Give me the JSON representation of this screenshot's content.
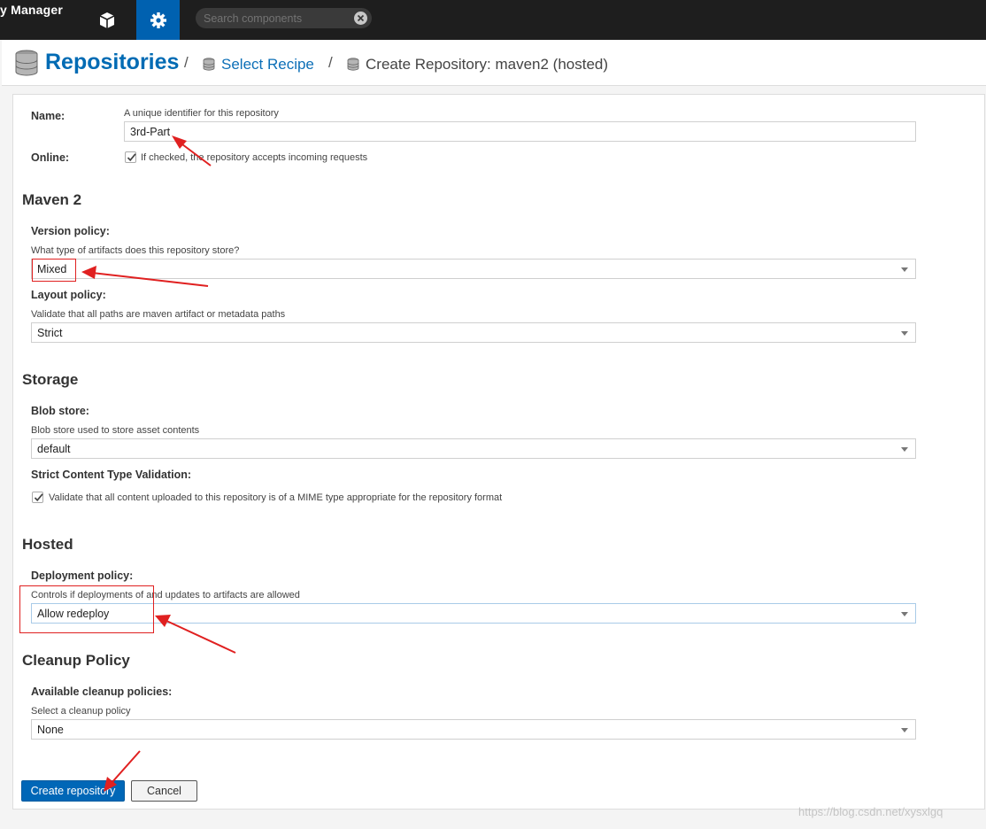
{
  "topbar": {
    "app_name": "y Manager",
    "browse_icon": "cube-icon",
    "admin_icon": "gear-icon",
    "search_placeholder": "Search components",
    "clear_icon": "close-circle-icon"
  },
  "breadcrumb": {
    "title": "Repositories",
    "separator": "/",
    "link": "Select Recipe",
    "current": "Create Repository: maven2 (hosted)"
  },
  "form": {
    "name": {
      "label": "Name:",
      "help": "A unique identifier for this repository",
      "value": "3rd-Part"
    },
    "online": {
      "label": "Online:",
      "help": "If checked, the repository accepts incoming requests",
      "checked": true
    },
    "maven": {
      "heading": "Maven 2",
      "version_policy": {
        "label": "Version policy:",
        "help": "What type of artifacts does this repository store?",
        "value": "Mixed"
      },
      "layout_policy": {
        "label": "Layout policy:",
        "help": "Validate that all paths are maven artifact or metadata paths",
        "value": "Strict"
      }
    },
    "storage": {
      "heading": "Storage",
      "blob_store": {
        "label": "Blob store:",
        "help": "Blob store used to store asset contents",
        "value": "default"
      },
      "strict_content": {
        "label": "Strict Content Type Validation:",
        "help": "Validate that all content uploaded to this repository is of a MIME type appropriate for the repository format",
        "checked": true
      }
    },
    "hosted": {
      "heading": "Hosted",
      "deployment_policy": {
        "label": "Deployment policy:",
        "help": "Controls if deployments of and updates to artifacts are allowed",
        "value": "Allow redeploy"
      }
    },
    "cleanup": {
      "heading": "Cleanup Policy",
      "available": {
        "label": "Available cleanup policies:",
        "help": "Select a cleanup policy",
        "value": "None"
      }
    },
    "create_label": "Create repository",
    "cancel_label": "Cancel"
  },
  "colors": {
    "accent": "#0061b0",
    "annotation": "#e02020"
  },
  "watermark": "https://blog.csdn.net/xysxlgq"
}
